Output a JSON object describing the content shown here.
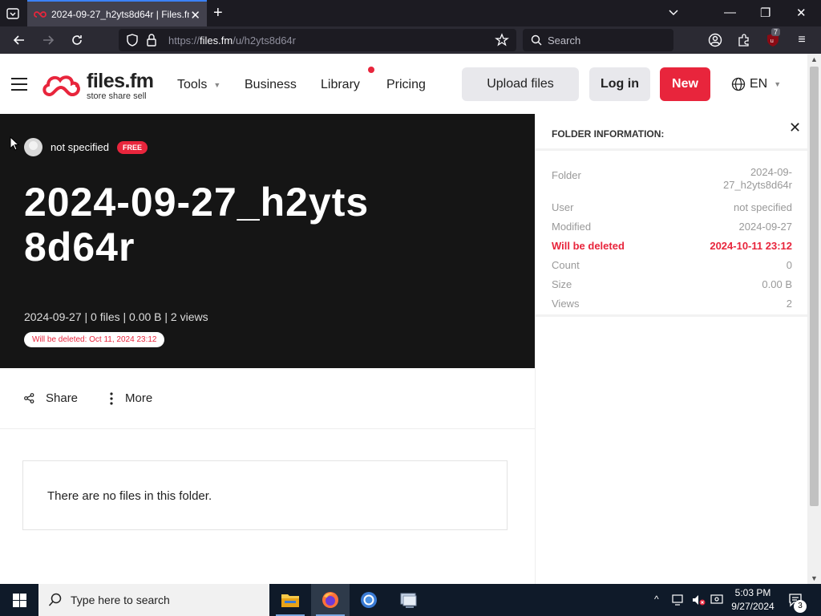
{
  "browser": {
    "tab_title": "2024-09-27_h2yts8d64r | Files.fm",
    "url_prefix": "https://",
    "url_host": "files.fm",
    "url_path": "/u/h2yts8d64r",
    "search_placeholder": "Search",
    "extension_badge": "7"
  },
  "header": {
    "logo_name": "files.fm",
    "logo_tagline": "store share sell",
    "menu": [
      {
        "label": "Tools"
      },
      {
        "label": "Business"
      },
      {
        "label": "Library"
      },
      {
        "label": "Pricing"
      }
    ],
    "upload_label": "Upload files",
    "login_label": "Log in",
    "new_label": "New",
    "language": "EN"
  },
  "hero": {
    "owner": "not specified",
    "badge": "FREE",
    "title": "2024-09-27_h2yts8d64r",
    "meta": "2024-09-27 | 0 files | 0.00  B | 2 views",
    "delete_notice": "Will be deleted: Oct 11, 2024 23:12"
  },
  "actions": {
    "share": "Share",
    "more": "More"
  },
  "empty_message": "There are no files in this folder.",
  "info": {
    "header": "FOLDER INFORMATION:",
    "rows": [
      {
        "key": "Folder",
        "value": "2024-09-27_h2yts8d64r"
      },
      {
        "key": "User",
        "value": "not specified"
      },
      {
        "key": "Modified",
        "value": "2024-09-27"
      },
      {
        "key": "Will be deleted",
        "value": "2024-10-11 23:12"
      },
      {
        "key": "Count",
        "value": "0"
      },
      {
        "key": "Size",
        "value": "0.00  B"
      },
      {
        "key": "Views",
        "value": "2"
      }
    ]
  },
  "taskbar": {
    "search_placeholder": "Type here to search",
    "time": "5:03 PM",
    "date": "9/27/2024",
    "notifications": "3"
  },
  "colors": {
    "accent": "#e8253c",
    "hero_bg": "#151515",
    "browser_chrome": "#2b2a33"
  }
}
